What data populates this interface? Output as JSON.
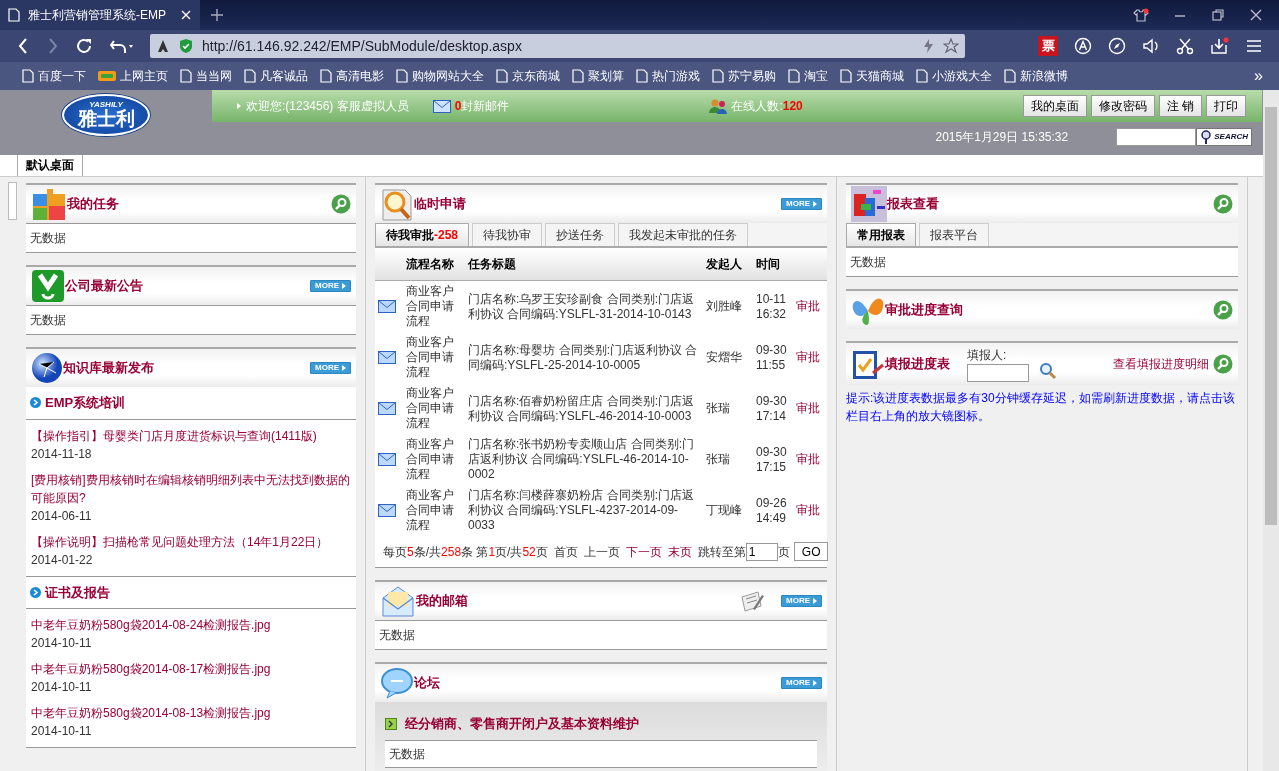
{
  "browser": {
    "tab_title": "雅士利营销管理系统-EMP",
    "url": "http://61.146.92.242/EMP/SubModule/desktop.aspx",
    "ext_badge": "票",
    "bookmarks": [
      {
        "label": "百度一下",
        "kind": "page"
      },
      {
        "label": "上网主页",
        "kind": "hao"
      },
      {
        "label": "当当网",
        "kind": "page"
      },
      {
        "label": "凡客诚品",
        "kind": "page"
      },
      {
        "label": "高清电影",
        "kind": "page"
      },
      {
        "label": "购物网站大全",
        "kind": "page"
      },
      {
        "label": "京东商城",
        "kind": "page"
      },
      {
        "label": "聚划算",
        "kind": "page"
      },
      {
        "label": "热门游戏",
        "kind": "page"
      },
      {
        "label": "苏宁易购",
        "kind": "page"
      },
      {
        "label": "淘宝",
        "kind": "page"
      },
      {
        "label": "天猫商城",
        "kind": "page"
      },
      {
        "label": "小游戏大全",
        "kind": "page"
      },
      {
        "label": "新浪微博",
        "kind": "page"
      }
    ],
    "more": "»"
  },
  "header": {
    "logo_top": "YASHILY",
    "logo_name": "雅士利",
    "welcome": "欢迎您:(123456) 客服虚拟人员",
    "mail_count": "0",
    "mail_label": "封新邮件",
    "online_label": "在线人数:",
    "online_count": "120",
    "buttons": [
      "我的桌面",
      "修改密码",
      "注 销",
      "打印"
    ],
    "datetime": "2015年1月29日 15:35:32",
    "search_button": "SEARCH"
  },
  "desk_tabs": [
    {
      "label": "默认桌面",
      "selected": true
    }
  ],
  "columns": [
    {
      "panels": [
        {
          "kind": "empty",
          "title": "我的任务",
          "search": true,
          "body": "无数据"
        },
        {
          "kind": "empty",
          "title": "公司最新公告",
          "more": "MORE",
          "body": "无数据"
        },
        {
          "kind": "knowledge",
          "title": "知识库最新发布",
          "more": "MORE",
          "sections": [
            {
              "title": "EMP系统培训",
              "items": [
                {
                  "title": "【操作指引】母婴类门店月度进货标识与查询(1411版)",
                  "date": "2014-11-18"
                },
                {
                  "title": "[费用核销]费用核销时在编辑核销明细列表中无法找到数据的可能原因?",
                  "date": "2014-06-11"
                },
                {
                  "title": "【操作说明】扫描枪常见问题处理方法（14年1月22日）",
                  "date": "2014-01-22"
                }
              ]
            },
            {
              "title": "证书及报告",
              "items": [
                {
                  "title": "中老年豆奶粉580g袋2014-08-24检测报告.jpg",
                  "date": "2014-10-11"
                },
                {
                  "title": "中老年豆奶粉580g袋2014-08-17检测报告.jpg",
                  "date": "2014-10-11"
                },
                {
                  "title": "中老年豆奶粉580g袋2014-08-13检测报告.jpg",
                  "date": "2014-10-11"
                }
              ]
            }
          ]
        }
      ]
    },
    {
      "panels": [
        {
          "kind": "approval",
          "title": "临时申请",
          "more": "MORE",
          "tabs": [
            {
              "label": "待我审批",
              "count": "-258",
              "selected": true
            },
            {
              "label": "待我协审",
              "selected": false
            },
            {
              "label": "抄送任务",
              "selected": false
            },
            {
              "label": "我发起未审批的任务",
              "selected": false
            }
          ],
          "columns": [
            "流程名称",
            "任务标题",
            "发起人",
            "时间"
          ],
          "rows": [
            {
              "flow": "商业客户合同申请流程",
              "title": "门店名称:乌罗王安珍副食 合同类别:门店返利协议 合同编码:YSLFL-31-2014-10-0143",
              "initiator": "刘胜峰",
              "time": "10-11 16:32",
              "action": "审批"
            },
            {
              "flow": "商业客户合同申请流程",
              "title": "门店名称:母婴坊 合同类别:门店返利协议 合同编码:YSLFL-25-2014-10-0005",
              "initiator": "安熠华",
              "time": "09-30 11:55",
              "action": "审批"
            },
            {
              "flow": "商业客户合同申请流程",
              "title": "门店名称:佰睿奶粉留庄店 合同类别:门店返利协议 合同编码:YSLFL-46-2014-10-0003",
              "initiator": "张瑞",
              "time": "09-30 17:14",
              "action": "审批"
            },
            {
              "flow": "商业客户合同申请流程",
              "title": "门店名称:张书奶粉专卖顺山店 合同类别:门店返利协议 合同编码:YSLFL-46-2014-10-0002",
              "initiator": "张瑞",
              "time": "09-30 17:15",
              "action": "审批"
            },
            {
              "flow": "商业客户合同申请流程",
              "title": "门店名称:闫楼薛寨奶粉店 合同类别:门店返利协议 合同编码:YSLFL-4237-2014-09-0033",
              "initiator": "丁现峰",
              "time": "09-26 14:49",
              "action": "审批"
            }
          ],
          "pager": {
            "parts": [
              {
                "text": "每页",
                "kind": "plain"
              },
              {
                "text": "5",
                "kind": "num"
              },
              {
                "text": "条/共",
                "kind": "plain"
              },
              {
                "text": "258",
                "kind": "num"
              },
              {
                "text": "条 第",
                "kind": "plain"
              },
              {
                "text": "1",
                "kind": "num"
              },
              {
                "text": "页/共",
                "kind": "plain"
              },
              {
                "text": "52",
                "kind": "num"
              },
              {
                "text": "页",
                "kind": "plain"
              }
            ],
            "links": [
              {
                "label": "首页",
                "disabled": true
              },
              {
                "label": "上一页",
                "disabled": true
              },
              {
                "label": "下一页",
                "disabled": false
              },
              {
                "label": "末页",
                "disabled": false
              }
            ],
            "jump_label": "跳转至第",
            "jump_value": "1",
            "jump_unit": "页",
            "go": "GO"
          }
        },
        {
          "kind": "empty",
          "title": "我的邮箱",
          "more": "MORE",
          "compose": true,
          "body": "无数据"
        },
        {
          "kind": "forum",
          "title": "论坛",
          "more": "MORE",
          "sections": [
            {
              "title": "经分销商、零售商开闭户及基本资料维护",
              "body": "无数据"
            }
          ]
        }
      ]
    },
    {
      "panels": [
        {
          "kind": "reports",
          "title": "报表查看",
          "search": true,
          "tabs": [
            {
              "label": "常用报表",
              "selected": true
            },
            {
              "label": "报表平台",
              "selected": false
            }
          ],
          "body": "无数据"
        },
        {
          "kind": "header",
          "title": "审批进度查询",
          "search": true
        },
        {
          "kind": "progress",
          "title": "填报进度表",
          "search": true,
          "field_label": "填报人:",
          "link": "查看填报进度明细",
          "notice": "提示:该进度表数据最多有30分钟缓存延迟，如需刷新进度数据，请点击该栏目右上角的放大镜图标。"
        }
      ]
    }
  ]
}
